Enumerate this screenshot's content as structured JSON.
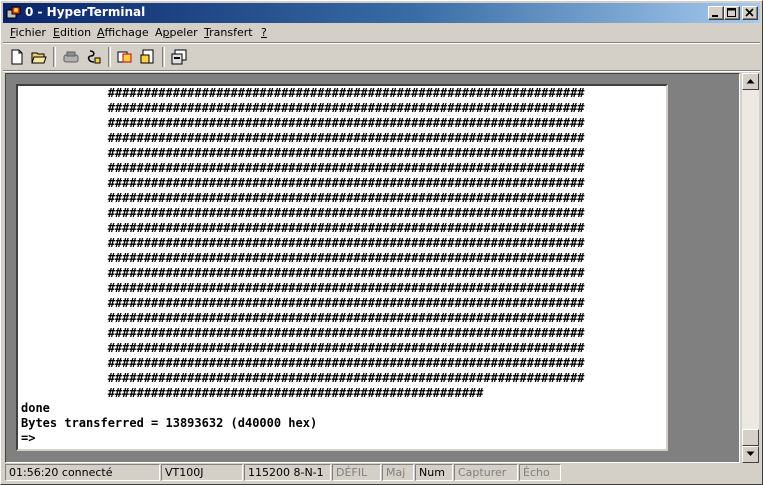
{
  "window": {
    "title": "0 - HyperTerminal"
  },
  "menu": [
    {
      "label": "Fichier",
      "accel": "F",
      "rest": "ichier"
    },
    {
      "label": "Edition",
      "accel": "E",
      "rest": "dition"
    },
    {
      "label": "Affichage",
      "accel": "A",
      "rest": "ffichage"
    },
    {
      "label": "Appeler",
      "accel": "p",
      "pre": "A",
      "rest": "peler"
    },
    {
      "label": "Transfert",
      "accel": "T",
      "rest": "ransfert"
    },
    {
      "label": "?",
      "accel": "?",
      "rest": ""
    }
  ],
  "toolbar": {
    "buttons": [
      "new-icon",
      "open-icon",
      "connect-icon",
      "disconnect-icon",
      "send-icon",
      "receive-icon",
      "properties-icon"
    ]
  },
  "terminal": {
    "hash_row": "            ##################################################################",
    "hash_row_last": "            ####################################################",
    "hash_row_count": 21,
    "line_done": "done",
    "line_bytes": "Bytes transferred = 13893632 (d40000 hex)",
    "line_prompt": "=>"
  },
  "status": {
    "connected": "01:56:20 connecté",
    "emulation": "VT100J",
    "settings": "115200 8-N-1",
    "scroll": "DÉFIL",
    "caps": "Maj",
    "num": "Num",
    "capture": "Capturer",
    "echo": "Écho"
  }
}
